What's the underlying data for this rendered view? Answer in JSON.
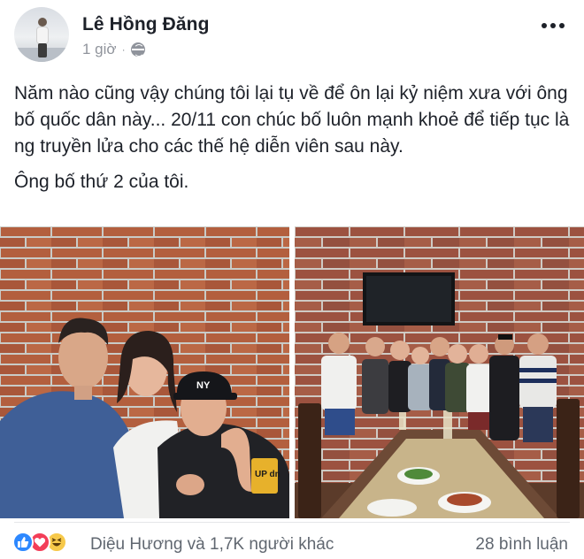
{
  "post": {
    "author": "Lê Hồng Đăng",
    "time": "1 giờ",
    "separator": "·",
    "privacy_icon": "globe-icon",
    "menu_icon": "more-options-icon",
    "paragraphs": [
      "Năm nào cũng vậy chúng tôi lại tụ về để ôn lại kỷ niệm xưa với ông bố quốc dân này... 20/11 con chúc bố luôn mạnh khoẻ để tiếp tục là ng truyền lửa cho các thế hệ diễn viên sau này.",
      "Ông bố thứ 2 của tôi."
    ]
  },
  "photos": [
    {
      "subject": "three-people-selfie-brick-wall",
      "cap_text": "NY",
      "shirt_text": "UP dn"
    },
    {
      "subject": "group-photo-dining-room"
    }
  ],
  "footer": {
    "reaction_icons": [
      "like-icon",
      "love-icon",
      "haha-icon"
    ],
    "reactions_summary": "Diệu Hương và 1,7K người khác",
    "comments": "28 bình luận"
  },
  "colors": {
    "like": "#2d88ff",
    "love": "#f33e58",
    "haha": "#f7c94a",
    "meta": "#90949c"
  }
}
